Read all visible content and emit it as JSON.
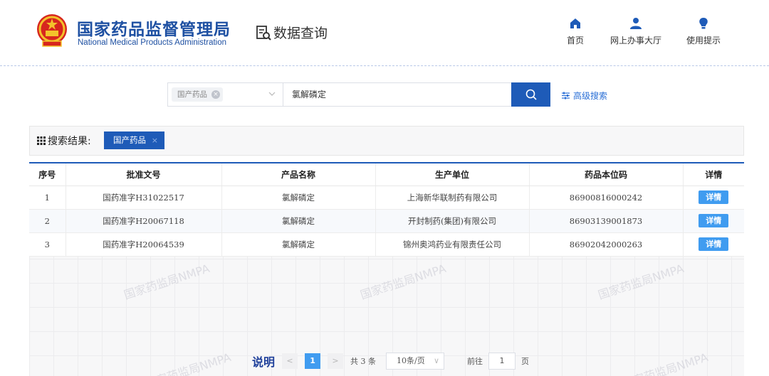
{
  "header": {
    "org_name": "国家药品监督管理局",
    "org_name_en": "National Medical Products Administration",
    "section_title": "数据查询",
    "nav": [
      {
        "label": "首页",
        "icon": "home-icon"
      },
      {
        "label": "网上办事大厅",
        "icon": "user-icon"
      },
      {
        "label": "使用提示",
        "icon": "lightbulb-icon"
      }
    ]
  },
  "search": {
    "category": "国产药品",
    "query": "氯解磷定",
    "advanced_label": "高级搜索"
  },
  "results": {
    "title": "搜索结果:",
    "active_tag": "国产药品",
    "columns": [
      "序号",
      "批准文号",
      "产品名称",
      "生产单位",
      "药品本位码",
      "详情"
    ],
    "rows": [
      {
        "no": "1",
        "approval": "国药准字H31022517",
        "product": "氯解磷定",
        "maker": "上海新华联制药有限公司",
        "code": "86900816000242",
        "detail": "详情"
      },
      {
        "no": "2",
        "approval": "国药准字H20067118",
        "product": "氯解磷定",
        "maker": "开封制药(集团)有限公司",
        "code": "86903139001873",
        "detail": "详情"
      },
      {
        "no": "3",
        "approval": "国药准字H20064539",
        "product": "氯解磷定",
        "maker": "锦州奥鸿药业有限责任公司",
        "code": "86902042000263",
        "detail": "详情"
      }
    ]
  },
  "watermark": "国家药监局NMPA",
  "pagination": {
    "note": "说明",
    "prev": "<",
    "current": "1",
    "next": ">",
    "total": "共 3 条",
    "page_size": "10条/页",
    "goto_label": "前往",
    "goto_value": "1",
    "goto_unit": "页"
  },
  "colors": {
    "brand_blue": "#1e50a2",
    "button_blue": "#1e5bb8",
    "detail_blue": "#409cf0"
  }
}
